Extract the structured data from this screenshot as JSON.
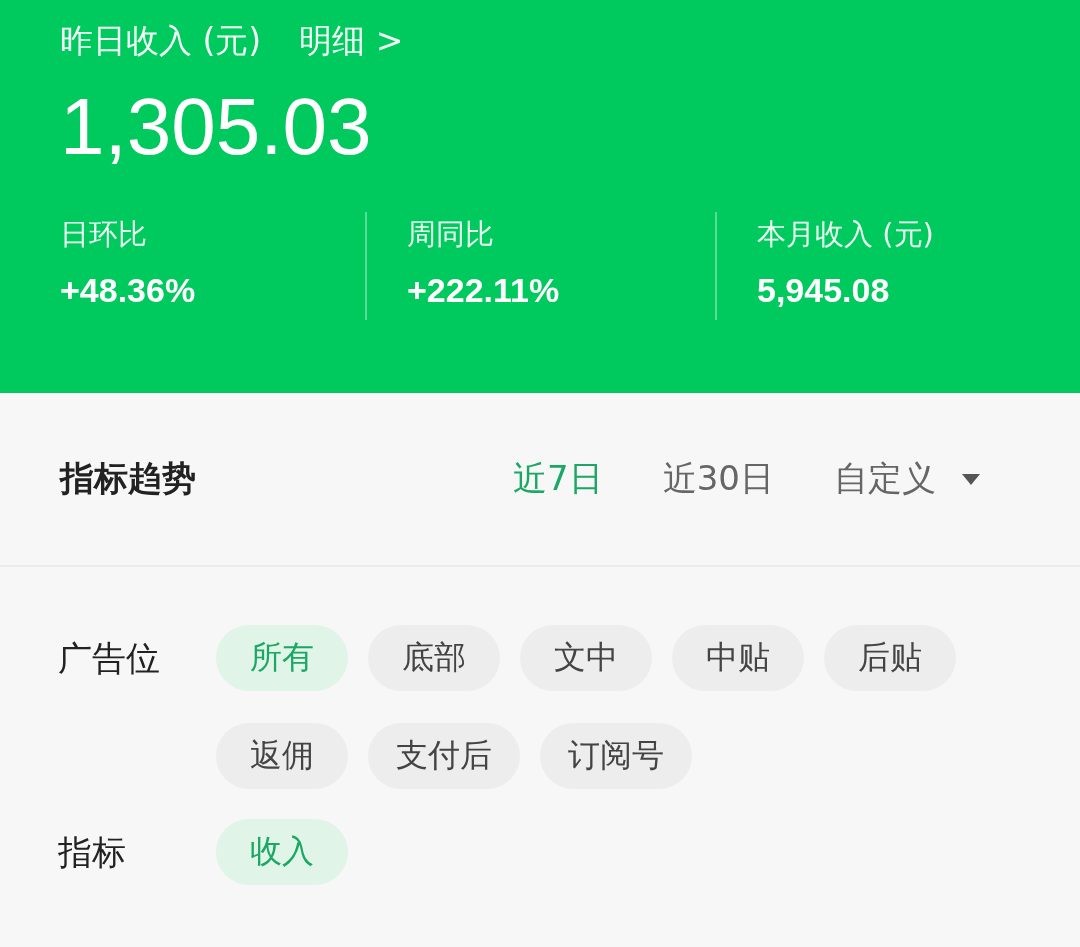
{
  "header": {
    "title": "昨日收入 (元)",
    "detail_link": "明细 >",
    "amount": "1,305.03",
    "stats": [
      {
        "label": "日环比",
        "value": "+48.36%"
      },
      {
        "label": "周同比",
        "value": "+222.11%"
      },
      {
        "label": "本月收入 (元)",
        "value": "5,945.08"
      }
    ]
  },
  "trend": {
    "title": "指标趋势",
    "ranges": [
      {
        "label": "近7日",
        "selected": true,
        "kind": "tab"
      },
      {
        "label": "近30日",
        "selected": false,
        "kind": "tab"
      },
      {
        "label": "自定义",
        "selected": false,
        "kind": "dropdown"
      }
    ]
  },
  "filters": [
    {
      "label": "广告位",
      "options": [
        {
          "label": "所有",
          "selected": true
        },
        {
          "label": "底部",
          "selected": false
        },
        {
          "label": "文中",
          "selected": false
        },
        {
          "label": "中贴",
          "selected": false
        },
        {
          "label": "后贴",
          "selected": false
        },
        {
          "label": "返佣",
          "selected": false
        },
        {
          "label": "支付后",
          "selected": false
        },
        {
          "label": "订阅号",
          "selected": false
        }
      ]
    },
    {
      "label": "指标",
      "options": [
        {
          "label": "收入",
          "selected": true
        }
      ]
    }
  ]
}
